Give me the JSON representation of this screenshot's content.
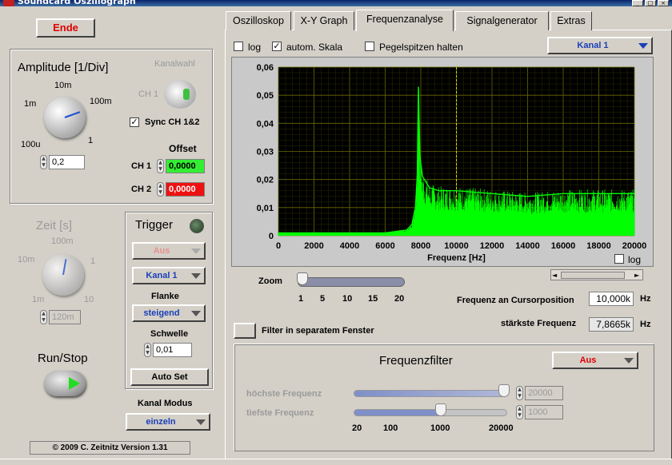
{
  "window": {
    "title": "Soundcard Oszillograph"
  },
  "left": {
    "ende": "Ende",
    "amplitude_title": "Amplitude [1/Div]",
    "amp_ticks": [
      "10m",
      "1m",
      "100m",
      "100u",
      "1"
    ],
    "amp_value": "0,2",
    "kanalwahl": "Kanalwahl",
    "ch1_dim": "CH 1",
    "sync": "Sync CH 1&2",
    "offset": "Offset",
    "ch1": "CH 1",
    "ch2": "CH 2",
    "offset_ch1": "0,0000",
    "offset_ch2": "0,0000",
    "zeit_title": "Zeit [s]",
    "zeit_ticks": [
      "100m",
      "10m",
      "1",
      "1m",
      "10"
    ],
    "zeit_value": "120m",
    "run_stop": "Run/Stop",
    "trigger": "Trigger",
    "trigger_mode": "Aus",
    "trigger_channel": "Kanal 1",
    "flanke": "Flanke",
    "flanke_value": "steigend",
    "schwelle": "Schwelle",
    "schwelle_value": "0,01",
    "auto_set": "Auto Set",
    "kanal_modus": "Kanal Modus",
    "kanal_modus_value": "einzeln",
    "copyright": "© 2009   C. Zeitnitz Version 1.31"
  },
  "tabs": [
    "Oszilloskop",
    "X-Y Graph",
    "Frequenzanalyse",
    "Signalgenerator",
    "Extras"
  ],
  "active_tab": 2,
  "spectrum": {
    "log_label": "log",
    "autoscale_label": "autom. Skala",
    "peak_hold_label": "Pegelspitzen halten",
    "channel": "Kanal 1",
    "log2_label": "log",
    "zoom_label": "Zoom",
    "zoom_ticks": [
      "1",
      "5",
      "10",
      "15",
      "20"
    ],
    "cursor_freq_label": "Frequenz an Cursorposition",
    "cursor_freq_value": "10,000k",
    "hz1": "Hz",
    "strongest_label": "stärkste Frequenz",
    "strongest_value": "7,8665k",
    "hz2": "Hz",
    "filter_window_label": "Filter in separatem Fenster"
  },
  "filter": {
    "title": "Frequenzfilter",
    "mode": "Aus",
    "high_label": "höchste Frequenz",
    "low_label": "tiefste Frequenz",
    "high_value": "20000",
    "low_value": "1000",
    "scale_ticks": [
      "20",
      "100",
      "1000",
      "20000"
    ]
  },
  "chart_data": {
    "type": "line",
    "xlabel": "Frequenz [Hz]",
    "ylabel": "",
    "xlim": [
      0,
      20000
    ],
    "ylim": [
      0,
      0.06
    ],
    "x_ticks": [
      "0",
      "2000",
      "4000",
      "6000",
      "8000",
      "10000",
      "12000",
      "14000",
      "16000",
      "18000",
      "20000"
    ],
    "y_ticks": [
      "0",
      "0,01",
      "0,02",
      "0,03",
      "0,04",
      "0,05",
      "0,06"
    ],
    "grid": true,
    "series": [
      {
        "color": "#00ff00",
        "x": [
          0,
          2000,
          4000,
          6000,
          7200,
          7500,
          7700,
          7800,
          7867,
          7950,
          8100,
          8500,
          9000,
          10000,
          12000,
          14000,
          16000,
          18000,
          20000
        ],
        "y": [
          0.001,
          0.001,
          0.001,
          0.001,
          0.002,
          0.004,
          0.01,
          0.022,
          0.053,
          0.028,
          0.021,
          0.017,
          0.016,
          0.016,
          0.015,
          0.014,
          0.015,
          0.015,
          0.015
        ]
      }
    ]
  }
}
